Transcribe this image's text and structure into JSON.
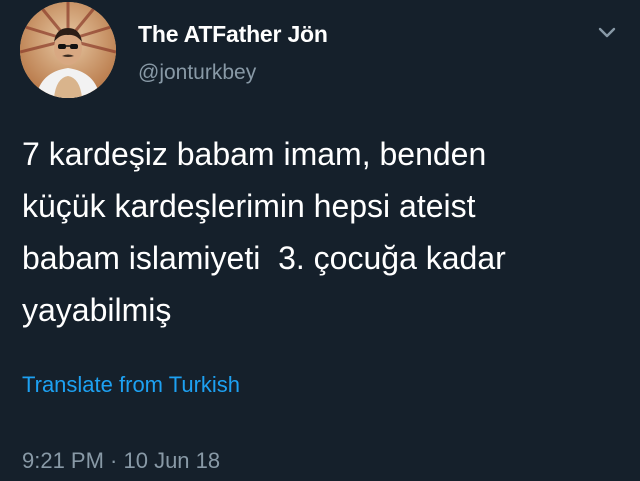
{
  "author": {
    "name": "The ATFather Jön",
    "handle": "@jonturkbey"
  },
  "tweet": {
    "lines": [
      "7 kardeşiz babam imam, benden",
      "küçük kardeşlerimin hepsi ateist",
      "babam islamiyeti  3. çocuğa kadar",
      "yayabilmiş"
    ]
  },
  "translate_label": "Translate from Turkish",
  "timestamp": "9:21 PM · 10 Jun 18",
  "icons": {
    "menu": "chevron-down-icon",
    "avatar": "profile-photo"
  },
  "colors": {
    "background": "#15202b",
    "text": "#ffffff",
    "secondary": "#8899a6",
    "link": "#1da1f2"
  }
}
